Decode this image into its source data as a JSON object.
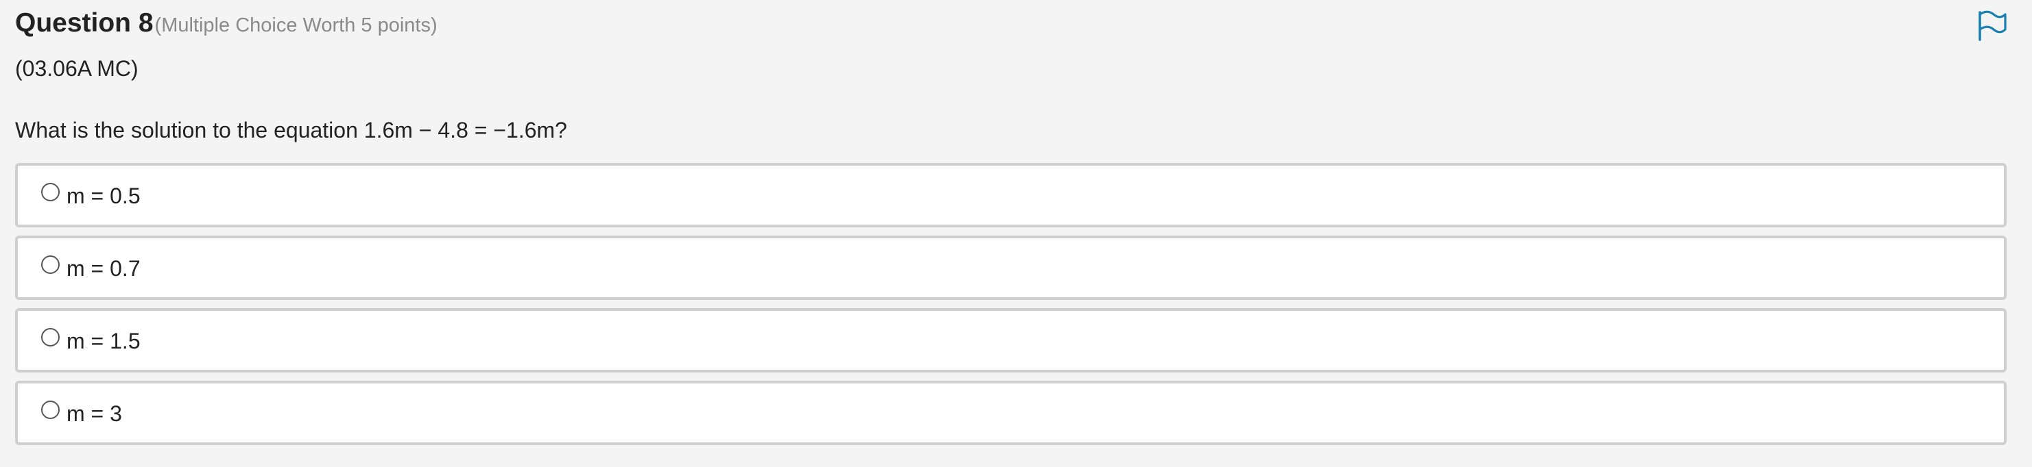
{
  "question": {
    "title": "Question 8",
    "meta": "(Multiple Choice Worth 5 points)",
    "code": "(03.06A MC)",
    "prompt": "What is the solution to the equation 1.6m − 4.8 = −1.6m?"
  },
  "flag": {
    "icon": "flag-icon",
    "color": "#1a7fb0"
  },
  "choices": [
    {
      "label": "m = 0.5",
      "selected": false
    },
    {
      "label": "m = 0.7",
      "selected": false
    },
    {
      "label": "m = 1.5",
      "selected": false
    },
    {
      "label": "m = 3",
      "selected": false
    }
  ]
}
